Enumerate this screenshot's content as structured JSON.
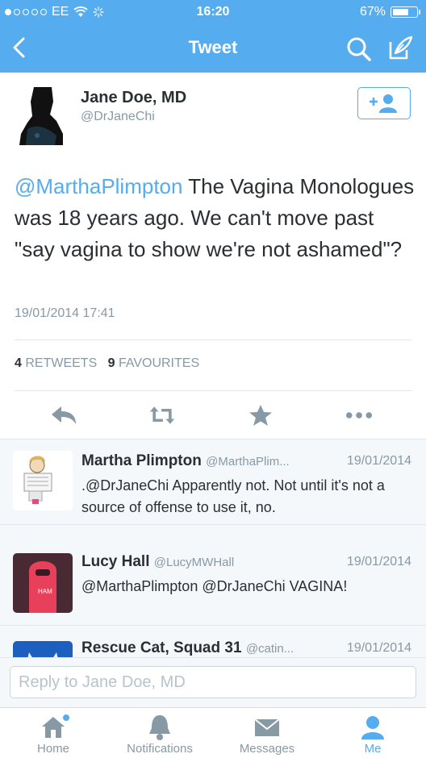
{
  "status_bar": {
    "carrier": "EE",
    "time": "16:20",
    "battery": "67%"
  },
  "nav": {
    "title": "Tweet"
  },
  "tweet": {
    "author_name": "Jane Doe, MD",
    "author_handle": "@DrJaneChi",
    "mention": "@MarthaPlimpton",
    "body": " The Vagina Monologues was 18 years ago. We can't move past \"say vagina to show we're not ashamed\"?",
    "timestamp": "19/01/2014 17:41",
    "retweets_count": "4",
    "retweets_label": "RETWEETS",
    "favourites_count": "9",
    "favourites_label": "FAVOURITES"
  },
  "replies": [
    {
      "name": "Martha Plimpton",
      "handle": "@MarthaPlim...",
      "date": "19/01/2014",
      "text": ".@DrJaneChi Apparently not. Not until it's not a source of offense to use it, no."
    },
    {
      "name": "Lucy Hall",
      "handle": "@LucyMWHall",
      "date": "19/01/2014",
      "text": "@MarthaPlimpton @DrJaneChi VAGINA!"
    },
    {
      "name": "Rescue Cat, Squad 31",
      "handle": "@catin...",
      "date": "19/01/2014",
      "text": ""
    }
  ],
  "reply_box": {
    "placeholder": "Reply to Jane Doe, MD"
  },
  "tabs": [
    {
      "label": "Home"
    },
    {
      "label": "Notifications"
    },
    {
      "label": "Messages"
    },
    {
      "label": "Me"
    }
  ],
  "colors": {
    "accent": "#55acee",
    "text": "#292f33",
    "muted": "#8899a6",
    "divider": "#e1e8ed",
    "icon_gray": "#8899a6"
  }
}
